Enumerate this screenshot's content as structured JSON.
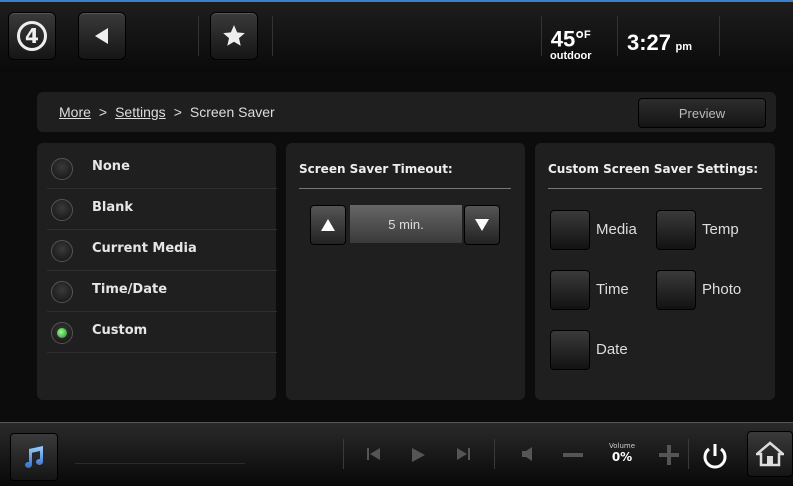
{
  "header": {
    "temperature": "45°",
    "temp_unit": "F",
    "temp_label": "outdoor",
    "time": "3:27",
    "time_ampm": "pm"
  },
  "breadcrumb": {
    "more": "More",
    "settings": "Settings",
    "current": "Screen Saver",
    "separator": ">"
  },
  "preview_label": "Preview",
  "screensaver_options": [
    {
      "label": "None",
      "selected": false
    },
    {
      "label": "Blank",
      "selected": false
    },
    {
      "label": "Current Media",
      "selected": false
    },
    {
      "label": "Time/Date",
      "selected": false
    },
    {
      "label": "Custom",
      "selected": true
    }
  ],
  "timeout": {
    "title": "Screen Saver Timeout:",
    "value": "5 min."
  },
  "custom_settings": {
    "title": "Custom Screen Saver Settings:",
    "items": [
      "Media",
      "Temp",
      "Time",
      "Photo",
      "Date"
    ]
  },
  "bottom": {
    "volume_label": "Volume",
    "volume_value": "0%"
  },
  "colors": {
    "accent": "#3d7fc6",
    "selected_radio": "#2ea52e"
  },
  "icons": [
    "logo-icon",
    "back-arrow-icon",
    "favorites-star-icon",
    "music-note-icon",
    "skip-back-icon",
    "play-icon",
    "skip-forward-icon",
    "speaker-icon",
    "volume-down-icon",
    "volume-up-icon",
    "power-icon",
    "home-icon",
    "up-arrow-icon",
    "down-arrow-icon"
  ]
}
